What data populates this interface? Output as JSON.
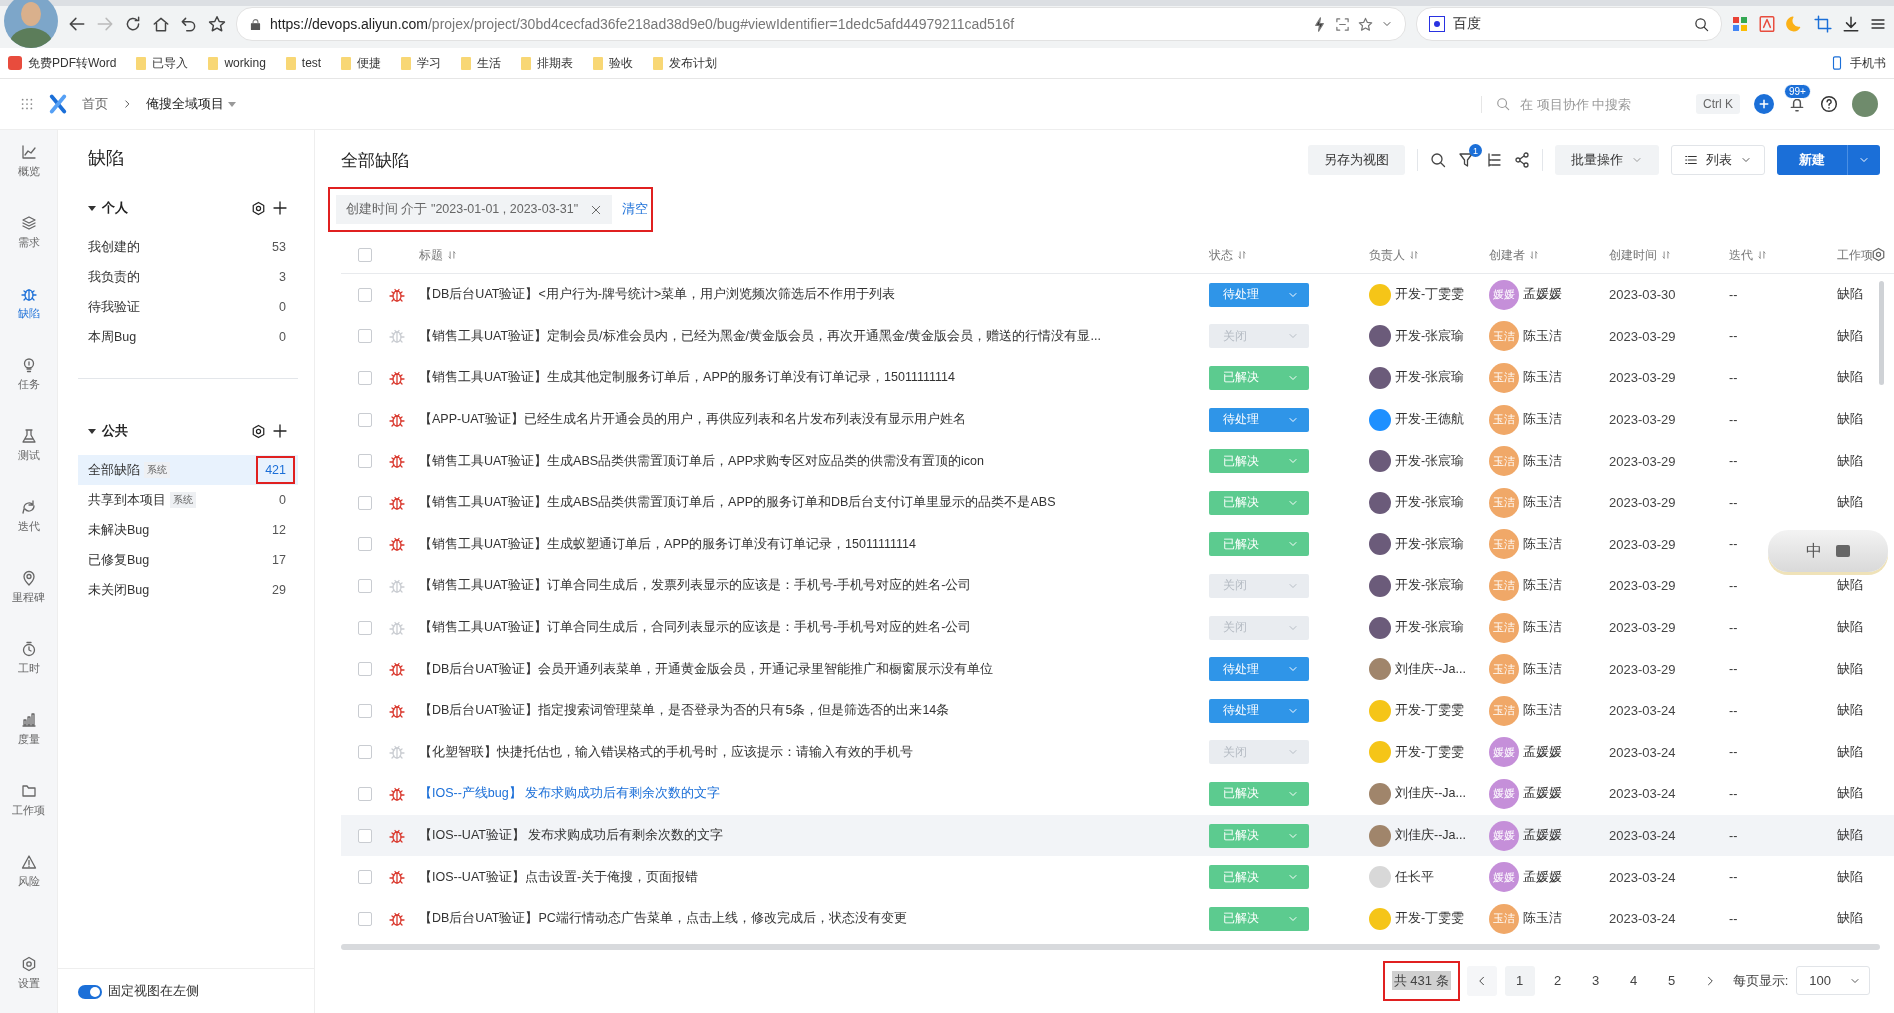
{
  "browser": {
    "url_host": "https://devops.aliyun.com",
    "url_path": "/projex/project/30bd4cecfad36fe218ad38d9e0/bug#viewIdentifier=1dedc5afd44979211cad516f",
    "search_engine": "百度",
    "bookmarks": [
      {
        "kind": "pdf",
        "label": "免费PDF转Word"
      },
      {
        "kind": "folder",
        "label": "已导入"
      },
      {
        "kind": "folder",
        "label": "working"
      },
      {
        "kind": "folder",
        "label": "test"
      },
      {
        "kind": "folder",
        "label": "便捷"
      },
      {
        "kind": "folder",
        "label": "学习"
      },
      {
        "kind": "folder",
        "label": "生活"
      },
      {
        "kind": "folder",
        "label": "排期表"
      },
      {
        "kind": "folder",
        "label": "验收"
      },
      {
        "kind": "folder",
        "label": "发布计划"
      }
    ],
    "mobile_bookmark": "手机书"
  },
  "header": {
    "breadcrumb": [
      "首页",
      "俺搜全域项目"
    ],
    "search": {
      "placeholder": "在 项目协作 中搜索"
    },
    "shortcut": "Ctrl K",
    "notifications": "99+"
  },
  "rail": [
    {
      "kind": "chart",
      "label": "概览",
      "selected": false
    },
    {
      "kind": "layers",
      "label": "需求",
      "selected": false
    },
    {
      "kind": "bug",
      "label": "缺陷",
      "selected": true
    },
    {
      "kind": "bulb",
      "label": "任务",
      "selected": false
    },
    {
      "kind": "flask",
      "label": "测试",
      "selected": false
    },
    {
      "kind": "cycle",
      "label": "迭代",
      "selected": false
    },
    {
      "kind": "pin",
      "label": "里程碑",
      "selected": false
    },
    {
      "kind": "clock",
      "label": "工时",
      "selected": false
    },
    {
      "kind": "bars",
      "label": "度量",
      "selected": false
    },
    {
      "kind": "folder",
      "label": "工作项",
      "selected": false
    },
    {
      "kind": "warning",
      "label": "风险",
      "selected": false
    }
  ],
  "rail_bottom": {
    "kind": "gear",
    "label": "设置"
  },
  "views": {
    "title": "缺陷",
    "groups": [
      {
        "title": "个人",
        "expanded": true,
        "items": [
          {
            "label": "我创建的",
            "count": "53",
            "selected": false
          },
          {
            "label": "我负责的",
            "count": "3",
            "selected": false
          },
          {
            "label": "待我验证",
            "count": "0",
            "selected": false
          },
          {
            "label": "本周Bug",
            "count": "0",
            "selected": false
          }
        ]
      },
      {
        "title": "公共",
        "expanded": true,
        "items": [
          {
            "label": "全部缺陷",
            "tag": "系统",
            "count": "421",
            "selected": true,
            "highlighted": true
          },
          {
            "label": "共享到本项目",
            "tag": "系统",
            "count": "0",
            "selected": false
          },
          {
            "label": "未解决Bug",
            "count": "12",
            "selected": false
          },
          {
            "label": "已修复Bug",
            "count": "17",
            "selected": false
          },
          {
            "label": "未关闭Bug",
            "count": "29",
            "selected": false
          }
        ]
      }
    ],
    "pin_toggle": {
      "label": "固定视图在左侧",
      "on": true
    }
  },
  "main": {
    "title": "全部缺陷",
    "save_view": "另存为视图",
    "filter_count": "1",
    "batch": "批量操作",
    "view_mode": "列表",
    "create": "新建",
    "select_all": false,
    "filter": {
      "text": "创建时间 介于 \"2023-01-01 , 2023-03-31\"",
      "clear": "清空",
      "highlighted": true
    },
    "columns": [
      "标题",
      "状态",
      "负责人",
      "创建者",
      "创建时间",
      "迭代",
      "工作项"
    ],
    "rows": [
      {
        "checked": false,
        "title": "【DB后台UAT验证】<用户行为-牌号统计>菜单，用户浏览频次筛选后不作用于列表",
        "link": false,
        "hovered": false,
        "status": {
          "kind": "pending",
          "label": "待处理"
        },
        "assignee": {
          "name": "开发-丁雯雯",
          "color": "#f5c518"
        },
        "creator": {
          "name": "孟媛媛",
          "avatar": "媛媛",
          "color": "#c58fd9"
        },
        "created": "2023-03-30",
        "iteration": "--",
        "type": "缺陷"
      },
      {
        "checked": false,
        "title": "【销售工具UAT验证】定制会员/标准会员内，已经为黑金/黄金版会员，再次开通黑金/黄金版会员，赠送的行情没有显...",
        "link": false,
        "hovered": false,
        "status": {
          "kind": "closed",
          "label": "关闭"
        },
        "assignee": {
          "name": "开发-张宸瑜",
          "color": "#6b5b7a"
        },
        "creator": {
          "name": "陈玉洁",
          "avatar": "玉洁",
          "color": "#f0a868"
        },
        "created": "2023-03-29",
        "iteration": "--",
        "type": "缺陷"
      },
      {
        "checked": false,
        "title": "【销售工具UAT验证】生成其他定制服务订单后，APP的服务订单没有订单记录，15011111114",
        "link": false,
        "hovered": false,
        "status": {
          "kind": "resolved",
          "label": "已解决"
        },
        "assignee": {
          "name": "开发-张宸瑜",
          "color": "#6b5b7a"
        },
        "creator": {
          "name": "陈玉洁",
          "avatar": "玉洁",
          "color": "#f0a868"
        },
        "created": "2023-03-29",
        "iteration": "--",
        "type": "缺陷"
      },
      {
        "checked": false,
        "title": "【APP-UAT验证】已经生成名片开通会员的用户，再供应列表和名片发布列表没有显示用户姓名",
        "link": false,
        "hovered": false,
        "status": {
          "kind": "pending",
          "label": "待处理"
        },
        "assignee": {
          "name": "开发-王德航",
          "color": "#1e90ff"
        },
        "creator": {
          "name": "陈玉洁",
          "avatar": "玉洁",
          "color": "#f0a868"
        },
        "created": "2023-03-29",
        "iteration": "--",
        "type": "缺陷"
      },
      {
        "checked": false,
        "title": "【销售工具UAT验证】生成ABS品类供需置顶订单后，APP求购专区对应品类的供需没有置顶的icon",
        "link": false,
        "hovered": false,
        "status": {
          "kind": "resolved",
          "label": "已解决"
        },
        "assignee": {
          "name": "开发-张宸瑜",
          "color": "#6b5b7a"
        },
        "creator": {
          "name": "陈玉洁",
          "avatar": "玉洁",
          "color": "#f0a868"
        },
        "created": "2023-03-29",
        "iteration": "--",
        "type": "缺陷"
      },
      {
        "checked": false,
        "title": "【销售工具UAT验证】生成ABS品类供需置顶订单后，APP的服务订单和DB后台支付订单里显示的品类不是ABS",
        "link": false,
        "hovered": false,
        "status": {
          "kind": "resolved",
          "label": "已解决"
        },
        "assignee": {
          "name": "开发-张宸瑜",
          "color": "#6b5b7a"
        },
        "creator": {
          "name": "陈玉洁",
          "avatar": "玉洁",
          "color": "#f0a868"
        },
        "created": "2023-03-29",
        "iteration": "--",
        "type": "缺陷"
      },
      {
        "checked": false,
        "title": "【销售工具UAT验证】生成蚁塑通订单后，APP的服务订单没有订单记录，15011111114",
        "link": false,
        "hovered": false,
        "status": {
          "kind": "resolved",
          "label": "已解决"
        },
        "assignee": {
          "name": "开发-张宸瑜",
          "color": "#6b5b7a"
        },
        "creator": {
          "name": "陈玉洁",
          "avatar": "玉洁",
          "color": "#f0a868"
        },
        "created": "2023-03-29",
        "iteration": "--"
      },
      {
        "checked": false,
        "title": "【销售工具UAT验证】订单合同生成后，发票列表显示的应该是：手机号-手机号对应的姓名-公司",
        "link": false,
        "hovered": false,
        "status": {
          "kind": "closed",
          "label": "关闭"
        },
        "assignee": {
          "name": "开发-张宸瑜",
          "color": "#6b5b7a"
        },
        "creator": {
          "name": "陈玉洁",
          "avatar": "玉洁",
          "color": "#f0a868"
        },
        "created": "2023-03-29",
        "iteration": "--",
        "type": "缺陷"
      },
      {
        "checked": false,
        "title": "【销售工具UAT验证】订单合同生成后，合同列表显示的应该是：手机号-手机号对应的姓名-公司",
        "link": false,
        "hovered": false,
        "status": {
          "kind": "closed",
          "label": "关闭"
        },
        "assignee": {
          "name": "开发-张宸瑜",
          "color": "#6b5b7a"
        },
        "creator": {
          "name": "陈玉洁",
          "avatar": "玉洁",
          "color": "#f0a868"
        },
        "created": "2023-03-29",
        "iteration": "--",
        "type": "缺陷"
      },
      {
        "checked": false,
        "title": "【DB后台UAT验证】会员开通列表菜单，开通黄金版会员，开通记录里智能推广和橱窗展示没有单位",
        "link": false,
        "hovered": false,
        "status": {
          "kind": "pending",
          "label": "待处理"
        },
        "assignee": {
          "name": "刘佳庆--Ja...",
          "color": "#a0856b"
        },
        "creator": {
          "name": "陈玉洁",
          "avatar": "玉洁",
          "color": "#f0a868"
        },
        "created": "2023-03-29",
        "iteration": "--",
        "type": "缺陷"
      },
      {
        "checked": false,
        "title": "【DB后台UAT验证】指定搜索词管理菜单，是否登录为否的只有5条，但是筛选否的出来14条",
        "link": false,
        "hovered": false,
        "status": {
          "kind": "pending",
          "label": "待处理"
        },
        "assignee": {
          "name": "开发-丁雯雯",
          "color": "#f5c518"
        },
        "creator": {
          "name": "陈玉洁",
          "avatar": "玉洁",
          "color": "#f0a868"
        },
        "created": "2023-03-24",
        "iteration": "--",
        "type": "缺陷"
      },
      {
        "checked": false,
        "title": "【化塑智联】快捷托估也，输入错误格式的手机号时，应该提示：请输入有效的手机号",
        "link": false,
        "hovered": false,
        "status": {
          "kind": "closed",
          "label": "关闭"
        },
        "assignee": {
          "name": "开发-丁雯雯",
          "color": "#f5c518"
        },
        "creator": {
          "name": "孟媛媛",
          "avatar": "媛媛",
          "color": "#c58fd9"
        },
        "created": "2023-03-24",
        "iteration": "--",
        "type": "缺陷"
      },
      {
        "checked": false,
        "title": "【IOS--产线bug】 发布求购成功后有剩余次数的文字",
        "link": true,
        "hovered": false,
        "status": {
          "kind": "resolved",
          "label": "已解决"
        },
        "assignee": {
          "name": "刘佳庆--Ja...",
          "color": "#a0856b"
        },
        "creator": {
          "name": "孟媛媛",
          "avatar": "媛媛",
          "color": "#c58fd9"
        },
        "created": "2023-03-24",
        "iteration": "--",
        "type": "缺陷"
      },
      {
        "checked": false,
        "title": "【IOS--UAT验证】 发布求购成功后有剩余次数的文字",
        "link": false,
        "hovered": true,
        "status": {
          "kind": "resolved",
          "label": "已解决"
        },
        "assignee": {
          "name": "刘佳庆--Ja...",
          "color": "#a0856b"
        },
        "creator": {
          "name": "孟媛媛",
          "avatar": "媛媛",
          "color": "#c58fd9"
        },
        "created": "2023-03-24",
        "iteration": "--",
        "type": "缺陷"
      },
      {
        "checked": false,
        "title": "【IOS--UAT验证】点击设置-关于俺搜，页面报错",
        "link": false,
        "hovered": false,
        "status": {
          "kind": "resolved",
          "label": "已解决"
        },
        "assignee": {
          "name": "任长平",
          "color": "#d8d8d8"
        },
        "creator": {
          "name": "孟媛媛",
          "avatar": "媛媛",
          "color": "#c58fd9"
        },
        "created": "2023-03-24",
        "iteration": "--",
        "type": "缺陷"
      },
      {
        "checked": false,
        "title": "【DB后台UAT验证】PC端行情动态广告菜单，点击上线，修改完成后，状态没有变更",
        "link": false,
        "hovered": false,
        "status": {
          "kind": "resolved",
          "label": "已解决"
        },
        "assignee": {
          "name": "开发-丁雯雯",
          "color": "#f5c518"
        },
        "creator": {
          "name": "陈玉洁",
          "avatar": "玉洁",
          "color": "#f0a868"
        },
        "created": "2023-03-24",
        "iteration": "--",
        "type": "缺陷"
      }
    ],
    "pagination": {
      "total": "共 431 条",
      "total_highlighted": true,
      "pages": [
        {
          "label": "1",
          "selected": true
        },
        {
          "label": "2",
          "selected": false
        },
        {
          "label": "3",
          "selected": false
        },
        {
          "label": "4",
          "selected": false
        },
        {
          "label": "5",
          "selected": false
        }
      ],
      "page_size_label": "每页显示:",
      "page_size": "100"
    }
  },
  "ime": {
    "label": "中"
  }
}
